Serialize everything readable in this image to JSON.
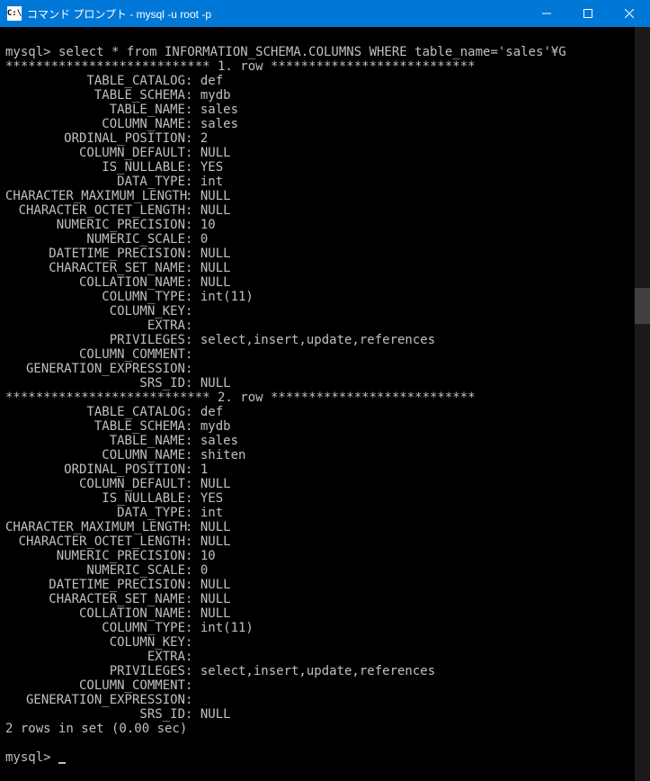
{
  "titlebar": {
    "icon_text": "C:\\",
    "title": "コマンド プロンプト - mysql  -u root -p"
  },
  "terminal": {
    "blank_line": "",
    "prompt1": "mysql> select * from INFORMATION_SCHEMA.COLUMNS WHERE table_name='sales'¥G",
    "sep1": "*************************** 1. row ***************************",
    "row1": {
      "TABLE_CATALOG": "def",
      "TABLE_SCHEMA": "mydb",
      "TABLE_NAME": "sales",
      "COLUMN_NAME": "sales",
      "ORDINAL_POSITION": "2",
      "COLUMN_DEFAULT": "NULL",
      "IS_NULLABLE": "YES",
      "DATA_TYPE": "int",
      "CHARACTER_MAXIMUM_LENGTH": "NULL",
      "CHARACTER_OCTET_LENGTH": "NULL",
      "NUMERIC_PRECISION": "10",
      "NUMERIC_SCALE": "0",
      "DATETIME_PRECISION": "NULL",
      "CHARACTER_SET_NAME": "NULL",
      "COLLATION_NAME": "NULL",
      "COLUMN_TYPE": "int(11)",
      "COLUMN_KEY": "",
      "EXTRA": "",
      "PRIVILEGES": "select,insert,update,references",
      "COLUMN_COMMENT": "",
      "GENERATION_EXPRESSION": "",
      "SRS_ID": "NULL"
    },
    "sep2": "*************************** 2. row ***************************",
    "row2": {
      "TABLE_CATALOG": "def",
      "TABLE_SCHEMA": "mydb",
      "TABLE_NAME": "sales",
      "COLUMN_NAME": "shiten",
      "ORDINAL_POSITION": "1",
      "COLUMN_DEFAULT": "NULL",
      "IS_NULLABLE": "YES",
      "DATA_TYPE": "int",
      "CHARACTER_MAXIMUM_LENGTH": "NULL",
      "CHARACTER_OCTET_LENGTH": "NULL",
      "NUMERIC_PRECISION": "10",
      "NUMERIC_SCALE": "0",
      "DATETIME_PRECISION": "NULL",
      "CHARACTER_SET_NAME": "NULL",
      "COLLATION_NAME": "NULL",
      "COLUMN_TYPE": "int(11)",
      "COLUMN_KEY": "",
      "EXTRA": "",
      "PRIVILEGES": "select,insert,update,references",
      "COLUMN_COMMENT": "",
      "GENERATION_EXPRESSION": "",
      "SRS_ID": "NULL"
    },
    "footer": "2 rows in set (0.00 sec)",
    "prompt2": "mysql> "
  },
  "labels": {
    "TABLE_CATALOG": "TABLE_CATALOG",
    "TABLE_SCHEMA": "TABLE_SCHEMA",
    "TABLE_NAME": "TABLE_NAME",
    "COLUMN_NAME": "COLUMN_NAME",
    "ORDINAL_POSITION": "ORDINAL_POSITION",
    "COLUMN_DEFAULT": "COLUMN_DEFAULT",
    "IS_NULLABLE": "IS_NULLABLE",
    "DATA_TYPE": "DATA_TYPE",
    "CHARACTER_MAXIMUM_LENGTH": "CHARACTER_MAXIMUM_LENGTH",
    "CHARACTER_OCTET_LENGTH": "CHARACTER_OCTET_LENGTH",
    "NUMERIC_PRECISION": "NUMERIC_PRECISION",
    "NUMERIC_SCALE": "NUMERIC_SCALE",
    "DATETIME_PRECISION": "DATETIME_PRECISION",
    "CHARACTER_SET_NAME": "CHARACTER_SET_NAME",
    "COLLATION_NAME": "COLLATION_NAME",
    "COLUMN_TYPE": "COLUMN_TYPE",
    "COLUMN_KEY": "COLUMN_KEY",
    "EXTRA": "EXTRA",
    "PRIVILEGES": "PRIVILEGES",
    "COLUMN_COMMENT": "COLUMN_COMMENT",
    "GENERATION_EXPRESSION": "GENERATION_EXPRESSION",
    "SRS_ID": "SRS_ID"
  }
}
